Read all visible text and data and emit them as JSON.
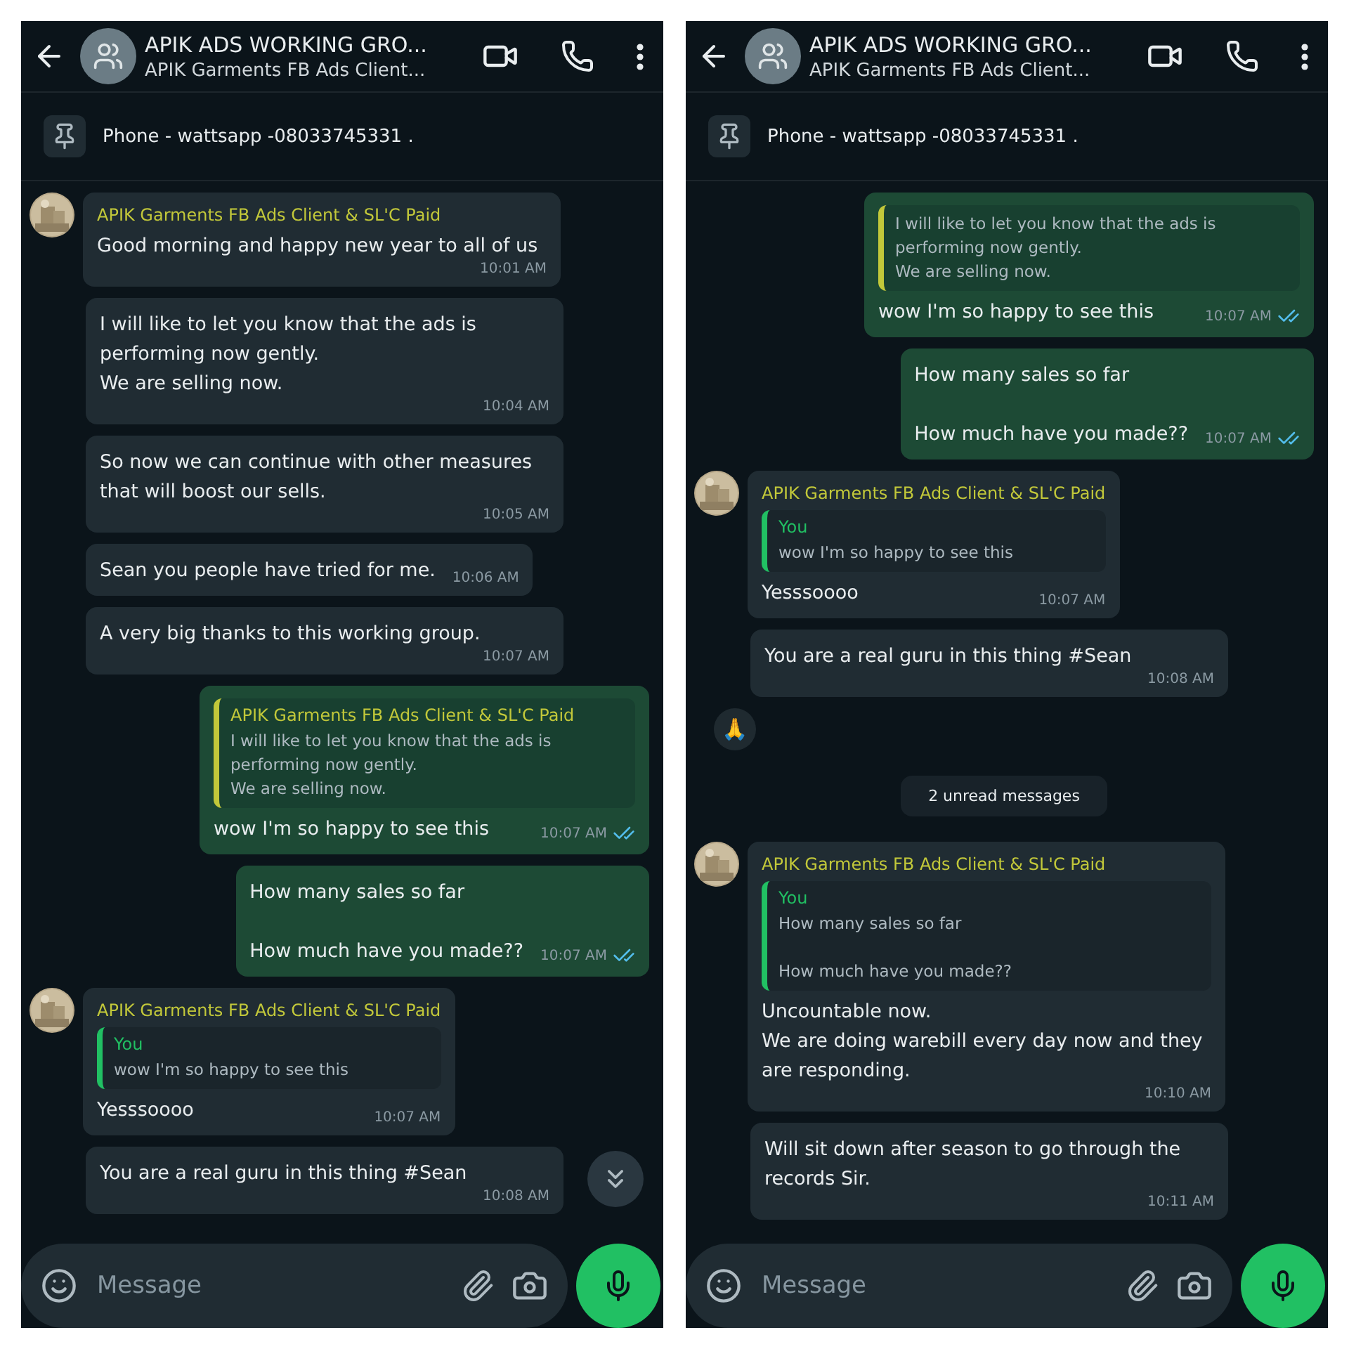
{
  "panels": [
    {
      "header": {
        "title": "APIK ADS WORKING GRO...",
        "subtitle": "APIK Garments FB Ads Client..."
      },
      "pinned": "Phone - wattsapp -08033745331 .",
      "messages": [
        {
          "kind": "incoming",
          "sender": "APIK Garments FB Ads Client & SL'C Paid",
          "text": "Good morning and happy new year to all of us",
          "time": "10:01 AM"
        },
        {
          "kind": "incoming",
          "text": "I will like to let you know that the ads is performing now gently.\nWe are selling now.",
          "time": "10:04 AM"
        },
        {
          "kind": "incoming",
          "text": "So now we can continue with other measures that will boost our sells.",
          "time": "10:05 AM"
        },
        {
          "kind": "incoming",
          "text": "Sean you people have tried for me.",
          "time": "10:06 AM"
        },
        {
          "kind": "incoming",
          "text": "A very big thanks to this working group.",
          "time": "10:07 AM"
        },
        {
          "kind": "outgoing",
          "quote": {
            "author": "APIK Garments FB Ads Client & SL'C Paid",
            "text": "I will like to let you know that the ads is performing now gently.\nWe are selling now."
          },
          "text": "wow I'm so happy to see this",
          "time": "10:07 AM",
          "read": true
        },
        {
          "kind": "outgoing",
          "text": "How many sales so far\n\nHow much have you made??",
          "time": "10:07 AM",
          "read": true
        },
        {
          "kind": "incoming",
          "sender": "APIK Garments FB Ads Client & SL'C Paid",
          "quote": {
            "author": "You",
            "text": "wow I'm so happy to see this"
          },
          "text": "Yesssoooo",
          "time": "10:07 AM"
        },
        {
          "kind": "incoming",
          "text": "You are a real guru in this thing #Sean",
          "time": "10:08 AM"
        }
      ],
      "scroll_down_button": true,
      "composer": {
        "placeholder": "Message"
      }
    },
    {
      "header": {
        "title": "APIK ADS WORKING GRO...",
        "subtitle": "APIK Garments FB Ads Client..."
      },
      "pinned": "Phone - wattsapp -08033745331 .",
      "messages": [
        {
          "kind": "outgoing",
          "quote": {
            "text": "I will like to let you know that the ads is performing now gently.\nWe are selling now."
          },
          "text": "wow I'm so happy to see this",
          "time": "10:07 AM",
          "read": true
        },
        {
          "kind": "outgoing",
          "text": "How many sales so far\n\nHow much have you made??",
          "time": "10:07 AM",
          "read": true
        },
        {
          "kind": "incoming",
          "sender": "APIK Garments FB Ads Client & SL'C Paid",
          "quote": {
            "author": "You",
            "text": "wow I'm so happy to see this"
          },
          "text": "Yesssoooo",
          "time": "10:07 AM"
        },
        {
          "kind": "incoming",
          "text": "You are a real guru in this thing #Sean",
          "time": "10:08 AM"
        },
        {
          "kind": "reaction",
          "text": "🙏"
        },
        {
          "kind": "divider",
          "text": "2 unread messages"
        },
        {
          "kind": "incoming",
          "sender": "APIK Garments FB Ads Client & SL'C Paid",
          "quote": {
            "author": "You",
            "text": "How many sales so far\n\nHow much have you made??"
          },
          "text": "Uncountable now.\nWe are doing warebill every day now and they are responding.",
          "time": "10:10 AM"
        },
        {
          "kind": "incoming",
          "text": "Will sit down after season to go through the records Sir.",
          "time": "10:11 AM"
        }
      ],
      "scroll_down_button": false,
      "composer": {
        "placeholder": "Message"
      }
    }
  ]
}
